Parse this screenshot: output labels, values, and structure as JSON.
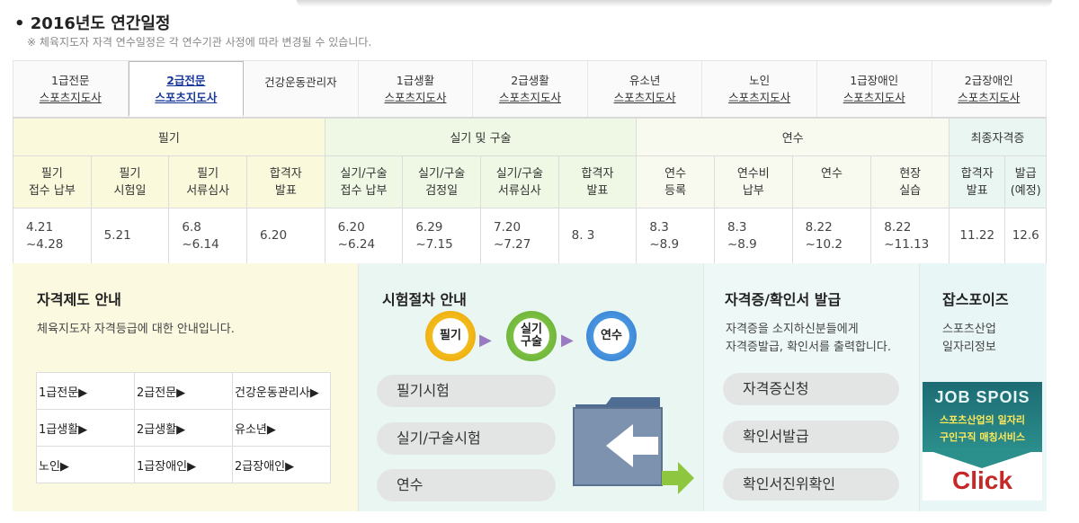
{
  "header": {
    "title": "• 2016년도 연간일정",
    "note": "※ 체육지도자 자격 연수일정은 각 연수기관 사정에 따라 변경될 수 있습니다."
  },
  "tabs": [
    {
      "line1": "1급전문",
      "line2": "스포츠지도사"
    },
    {
      "line1": "2급전문",
      "line2": "스포츠지도사"
    },
    {
      "line1": "건강운동관리자",
      "line2": ""
    },
    {
      "line1": "1급생활",
      "line2": "스포츠지도사"
    },
    {
      "line1": "2급생활",
      "line2": "스포츠지도사"
    },
    {
      "line1": "유소년",
      "line2": "스포츠지도사"
    },
    {
      "line1": "노인",
      "line2": "스포츠지도사"
    },
    {
      "line1": "1급장애인",
      "line2": "스포츠지도사"
    },
    {
      "line1": "2급장애인",
      "line2": "스포츠지도사"
    }
  ],
  "schedule": {
    "groups": [
      "필기",
      "실기 및 구술",
      "연수",
      "최종자격증"
    ],
    "columns": [
      {
        "l1": "필기",
        "l2": "접수 납부"
      },
      {
        "l1": "필기",
        "l2": "시험일"
      },
      {
        "l1": "필기",
        "l2": "서류심사"
      },
      {
        "l1": "합격자",
        "l2": "발표"
      },
      {
        "l1": "실기/구술",
        "l2": "접수 납부"
      },
      {
        "l1": "실기/구술",
        "l2": "검정일"
      },
      {
        "l1": "실기/구술",
        "l2": "서류심사"
      },
      {
        "l1": "합격자",
        "l2": "발표"
      },
      {
        "l1": "연수",
        "l2": "등록"
      },
      {
        "l1": "연수비",
        "l2": "납부"
      },
      {
        "l1": "연수",
        "l2": ""
      },
      {
        "l1": "현장",
        "l2": "실습"
      },
      {
        "l1": "합격자",
        "l2": "발표"
      },
      {
        "l1": "발급",
        "l2": "(예정)"
      }
    ],
    "values": [
      {
        "l1": "4.21",
        "l2": "~4.28"
      },
      {
        "l1": "5.21",
        "l2": ""
      },
      {
        "l1": "6.8",
        "l2": "~6.14"
      },
      {
        "l1": "6.20",
        "l2": ""
      },
      {
        "l1": "6.20",
        "l2": "~6.24"
      },
      {
        "l1": "6.29",
        "l2": "~7.15"
      },
      {
        "l1": "7.20",
        "l2": "~7.27"
      },
      {
        "l1": "8. 3",
        "l2": ""
      },
      {
        "l1": "8.3",
        "l2": "~8.9"
      },
      {
        "l1": "8.3",
        "l2": "~8.9"
      },
      {
        "l1": "8.22",
        "l2": "~10.2"
      },
      {
        "l1": "8.22",
        "l2": "~11.13"
      },
      {
        "l1": "11.22",
        "l2": ""
      },
      {
        "l1": "12.6",
        "l2": ""
      }
    ]
  },
  "guide": {
    "title": "자격제도 안내",
    "desc": "체육지도자 자격등급에 대한 안내입니다.",
    "links": [
      "1급전문▶",
      "2급전문▶",
      "건강운동관리사▶",
      "1급생활▶",
      "2급생활▶",
      "유소년▶",
      "노인▶",
      "1급장애인▶",
      "2급장애인▶"
    ]
  },
  "procedure": {
    "title": "시험절차 안내",
    "steps": [
      {
        "l1": "필기",
        "l2": "",
        "color": "#f2b400"
      },
      {
        "l1": "실기",
        "l2": "구술",
        "color": "#7cc242"
      },
      {
        "l1": "연수",
        "l2": "",
        "color": "#3c8ee0"
      }
    ],
    "buttons": [
      "필기시험",
      "실기/구술시험",
      "연수"
    ]
  },
  "certificate": {
    "title": "자격증/확인서 발급",
    "desc1": "자격증을 소지하신분들에게",
    "desc2": "자격증발급, 확인서를 출력합니다.",
    "buttons": [
      "자격증신청",
      "확인서발급",
      "확인서진위확인"
    ]
  },
  "jobspois": {
    "title": "잡스포이즈",
    "desc1": "스포츠산업",
    "desc2": "일자리정보",
    "banner_top": "JOB SPOIS",
    "banner_l1": "스포츠산업의 일자리",
    "banner_l2": "구인구직 매칭서비스",
    "banner_click": "Click"
  }
}
